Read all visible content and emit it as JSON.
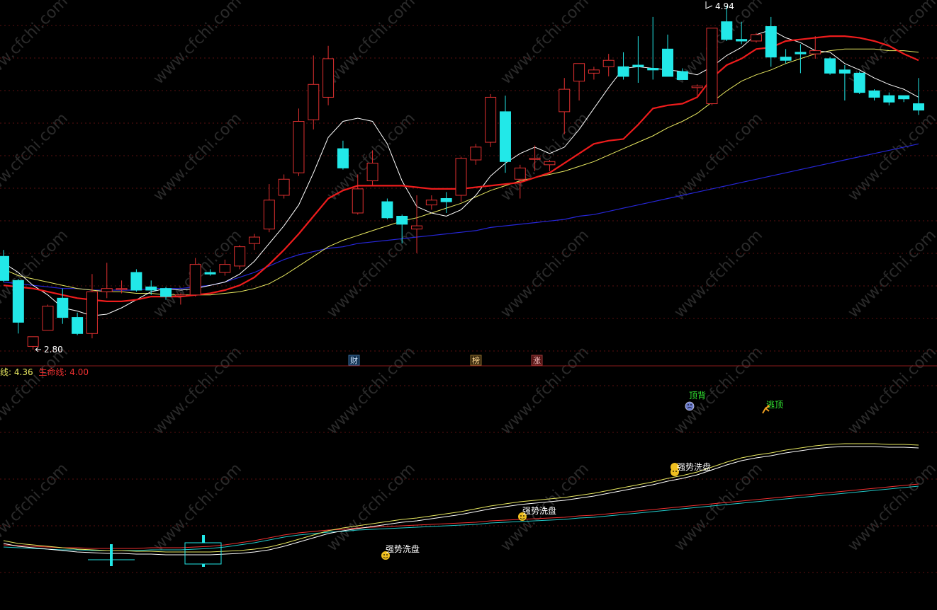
{
  "colors": {
    "up": "#e03030",
    "down": "#22e8e8",
    "ma5": "#ffffff",
    "ma10": "#ee1c1c",
    "ma20": "#e8e860",
    "ma60": "#2626d8",
    "grid": "#5a1010",
    "divider": "#8a1a1a",
    "sub_white": "#ffffff",
    "sub_yellow": "#e8e860",
    "sub_red": "#ee3030",
    "sub_cyan": "#22c8c8"
  },
  "labels": {
    "high_label": "4.94",
    "low_label": "2.80",
    "marker_cai": "财",
    "marker_bang": "榜",
    "marker_zhang": "涨",
    "legend_line1_name": "线:",
    "legend_line1_value": "4.36",
    "legend_line2_name": "生命线:",
    "legend_line2_value": "4.00",
    "sig_dingbei": "顶背",
    "sig_taoding": "逃顶",
    "sig_xipan1": "强势洗盘",
    "sig_xipan2": "强势洗盘",
    "sig_xipan3": "强势洗盘",
    "watermark": "www.cfchi.com"
  },
  "chart_data": {
    "type": "candlestick",
    "price_axis_reference": {
      "high": 4.94,
      "low": 2.8
    },
    "candles": [
      {
        "o": 3.38,
        "h": 3.42,
        "l": 3.22,
        "c": 3.23
      },
      {
        "o": 3.23,
        "h": 3.24,
        "l": 2.9,
        "c": 2.97
      },
      {
        "o": 2.82,
        "h": 2.88,
        "l": 2.8,
        "c": 2.88
      },
      {
        "o": 2.92,
        "h": 3.08,
        "l": 2.92,
        "c": 3.07
      },
      {
        "o": 3.12,
        "h": 3.18,
        "l": 2.96,
        "c": 3.0
      },
      {
        "o": 3.0,
        "h": 3.03,
        "l": 2.89,
        "c": 2.9
      },
      {
        "o": 2.9,
        "h": 3.27,
        "l": 2.87,
        "c": 3.16
      },
      {
        "o": 3.16,
        "h": 3.34,
        "l": 3.12,
        "c": 3.18
      },
      {
        "o": 3.18,
        "h": 3.23,
        "l": 3.15,
        "c": 3.18
      },
      {
        "o": 3.28,
        "h": 3.3,
        "l": 3.16,
        "c": 3.17
      },
      {
        "o": 3.19,
        "h": 3.23,
        "l": 3.14,
        "c": 3.17
      },
      {
        "o": 3.18,
        "h": 3.19,
        "l": 3.11,
        "c": 3.13
      },
      {
        "o": 3.14,
        "h": 3.15,
        "l": 3.08,
        "c": 3.14
      },
      {
        "o": 3.14,
        "h": 3.37,
        "l": 3.13,
        "c": 3.33
      },
      {
        "o": 3.28,
        "h": 3.3,
        "l": 3.26,
        "c": 3.27
      },
      {
        "o": 3.28,
        "h": 3.36,
        "l": 3.26,
        "c": 3.33
      },
      {
        "o": 3.32,
        "h": 3.45,
        "l": 3.3,
        "c": 3.44
      },
      {
        "o": 3.46,
        "h": 3.52,
        "l": 3.42,
        "c": 3.5
      },
      {
        "o": 3.55,
        "h": 3.83,
        "l": 3.53,
        "c": 3.73
      },
      {
        "o": 3.76,
        "h": 3.89,
        "l": 3.74,
        "c": 3.86
      },
      {
        "o": 3.9,
        "h": 4.3,
        "l": 3.88,
        "c": 4.22
      },
      {
        "o": 4.23,
        "h": 4.63,
        "l": 4.17,
        "c": 4.45
      },
      {
        "o": 4.37,
        "h": 4.69,
        "l": 4.32,
        "c": 4.61
      },
      {
        "o": 4.05,
        "h": 4.1,
        "l": 3.92,
        "c": 3.93
      },
      {
        "o": 3.65,
        "h": 3.89,
        "l": 3.64,
        "c": 3.8
      },
      {
        "o": 3.85,
        "h": 4.04,
        "l": 3.82,
        "c": 3.96
      },
      {
        "o": 3.72,
        "h": 3.74,
        "l": 3.61,
        "c": 3.62
      },
      {
        "o": 3.63,
        "h": 3.64,
        "l": 3.46,
        "c": 3.58
      },
      {
        "o": 3.55,
        "h": 3.76,
        "l": 3.4,
        "c": 3.57
      },
      {
        "o": 3.7,
        "h": 3.76,
        "l": 3.67,
        "c": 3.73
      },
      {
        "o": 3.74,
        "h": 3.78,
        "l": 3.65,
        "c": 3.72
      },
      {
        "o": 3.76,
        "h": 4.0,
        "l": 3.72,
        "c": 3.99
      },
      {
        "o": 3.98,
        "h": 4.08,
        "l": 3.95,
        "c": 4.06
      },
      {
        "o": 4.09,
        "h": 4.39,
        "l": 4.06,
        "c": 4.37
      },
      {
        "o": 4.28,
        "h": 4.38,
        "l": 3.9,
        "c": 3.97
      },
      {
        "o": 3.86,
        "h": 3.95,
        "l": 3.74,
        "c": 3.93
      },
      {
        "o": 3.99,
        "h": 4.07,
        "l": 3.91,
        "c": 3.99
      },
      {
        "o": 3.95,
        "h": 3.98,
        "l": 3.91,
        "c": 3.97
      },
      {
        "o": 4.28,
        "h": 4.49,
        "l": 4.14,
        "c": 4.42
      },
      {
        "o": 4.47,
        "h": 4.58,
        "l": 4.35,
        "c": 4.58
      },
      {
        "o": 4.52,
        "h": 4.56,
        "l": 4.48,
        "c": 4.54
      },
      {
        "o": 4.56,
        "h": 4.64,
        "l": 4.5,
        "c": 4.6
      },
      {
        "o": 4.56,
        "h": 4.65,
        "l": 4.48,
        "c": 4.5
      },
      {
        "o": 4.57,
        "h": 4.75,
        "l": 4.46,
        "c": 4.56
      },
      {
        "o": 4.55,
        "h": 4.87,
        "l": 4.48,
        "c": 4.54
      },
      {
        "o": 4.67,
        "h": 4.76,
        "l": 4.5,
        "c": 4.5
      },
      {
        "o": 4.53,
        "h": 4.55,
        "l": 4.48,
        "c": 4.48
      },
      {
        "o": 4.43,
        "h": 4.45,
        "l": 4.38,
        "c": 4.44
      },
      {
        "o": 4.33,
        "h": 4.66,
        "l": 4.32,
        "c": 4.8
      },
      {
        "o": 4.84,
        "h": 4.94,
        "l": 4.72,
        "c": 4.73
      },
      {
        "o": 4.73,
        "h": 4.84,
        "l": 4.7,
        "c": 4.72
      },
      {
        "o": 4.72,
        "h": 4.77,
        "l": 4.71,
        "c": 4.76
      },
      {
        "o": 4.81,
        "h": 4.87,
        "l": 4.56,
        "c": 4.62
      },
      {
        "o": 4.62,
        "h": 4.67,
        "l": 4.58,
        "c": 4.6
      },
      {
        "o": 4.65,
        "h": 4.7,
        "l": 4.52,
        "c": 4.64
      },
      {
        "o": 4.64,
        "h": 4.75,
        "l": 4.61,
        "c": 4.66
      },
      {
        "o": 4.61,
        "h": 4.62,
        "l": 4.51,
        "c": 4.52
      },
      {
        "o": 4.54,
        "h": 4.57,
        "l": 4.35,
        "c": 4.52
      },
      {
        "o": 4.52,
        "h": 4.53,
        "l": 4.39,
        "c": 4.4
      },
      {
        "o": 4.41,
        "h": 4.42,
        "l": 4.35,
        "c": 4.37
      },
      {
        "o": 4.38,
        "h": 4.4,
        "l": 4.32,
        "c": 4.34
      },
      {
        "o": 4.38,
        "h": 4.38,
        "l": 4.34,
        "c": 4.36
      },
      {
        "o": 4.33,
        "h": 4.49,
        "l": 4.26,
        "c": 4.29
      }
    ],
    "ma5": [
      3.34,
      3.28,
      3.2,
      3.14,
      3.06,
      3.04,
      3.01,
      3.02,
      3.06,
      3.11,
      3.16,
      3.18,
      3.17,
      3.18,
      3.2,
      3.22,
      3.27,
      3.35,
      3.46,
      3.57,
      3.7,
      3.9,
      4.12,
      4.22,
      4.24,
      4.22,
      4.08,
      3.85,
      3.69,
      3.65,
      3.63,
      3.67,
      3.76,
      3.88,
      3.96,
      4.02,
      4.06,
      4.02,
      4.06,
      4.17,
      4.3,
      4.43,
      4.55,
      4.56,
      4.55,
      4.54,
      4.53,
      4.51,
      4.56,
      4.63,
      4.68,
      4.76,
      4.79,
      4.74,
      4.71,
      4.66,
      4.65,
      4.58,
      4.54,
      4.49,
      4.45,
      4.42,
      4.37
    ],
    "ma10": [
      3.2,
      3.19,
      3.18,
      3.16,
      3.14,
      3.12,
      3.11,
      3.1,
      3.1,
      3.11,
      3.13,
      3.13,
      3.13,
      3.14,
      3.15,
      3.17,
      3.2,
      3.25,
      3.33,
      3.42,
      3.52,
      3.63,
      3.74,
      3.79,
      3.82,
      3.82,
      3.82,
      3.82,
      3.81,
      3.8,
      3.8,
      3.8,
      3.81,
      3.82,
      3.83,
      3.84,
      3.87,
      3.9,
      3.96,
      4.02,
      4.08,
      4.1,
      4.11,
      4.2,
      4.3,
      4.32,
      4.33,
      4.37,
      4.49,
      4.57,
      4.61,
      4.67,
      4.68,
      4.72,
      4.73,
      4.74,
      4.75,
      4.75,
      4.74,
      4.72,
      4.69,
      4.64,
      4.6
    ],
    "ma20": [
      3.3,
      3.26,
      3.24,
      3.22,
      3.2,
      3.18,
      3.17,
      3.16,
      3.16,
      3.15,
      3.15,
      3.14,
      3.14,
      3.14,
      3.14,
      3.15,
      3.16,
      3.18,
      3.21,
      3.26,
      3.32,
      3.38,
      3.44,
      3.48,
      3.51,
      3.54,
      3.57,
      3.6,
      3.62,
      3.65,
      3.68,
      3.71,
      3.75,
      3.79,
      3.82,
      3.85,
      3.87,
      3.89,
      3.91,
      3.94,
      3.97,
      4.01,
      4.05,
      4.09,
      4.13,
      4.18,
      4.22,
      4.27,
      4.34,
      4.41,
      4.47,
      4.51,
      4.54,
      4.58,
      4.61,
      4.64,
      4.66,
      4.67,
      4.67,
      4.67,
      4.66,
      4.66,
      4.65
    ],
    "ma60": [
      3.22,
      3.21,
      3.2,
      3.19,
      3.18,
      3.18,
      3.17,
      3.17,
      3.17,
      3.17,
      3.18,
      3.18,
      3.18,
      3.19,
      3.2,
      3.22,
      3.25,
      3.28,
      3.32,
      3.36,
      3.39,
      3.41,
      3.43,
      3.44,
      3.46,
      3.47,
      3.48,
      3.49,
      3.5,
      3.51,
      3.52,
      3.53,
      3.54,
      3.56,
      3.57,
      3.58,
      3.59,
      3.6,
      3.61,
      3.63,
      3.64,
      3.66,
      3.68,
      3.7,
      3.72,
      3.74,
      3.76,
      3.78,
      3.8,
      3.82,
      3.84,
      3.86,
      3.88,
      3.9,
      3.92,
      3.94,
      3.96,
      3.98,
      4.0,
      4.02,
      4.04,
      4.06,
      4.08
    ]
  }
}
